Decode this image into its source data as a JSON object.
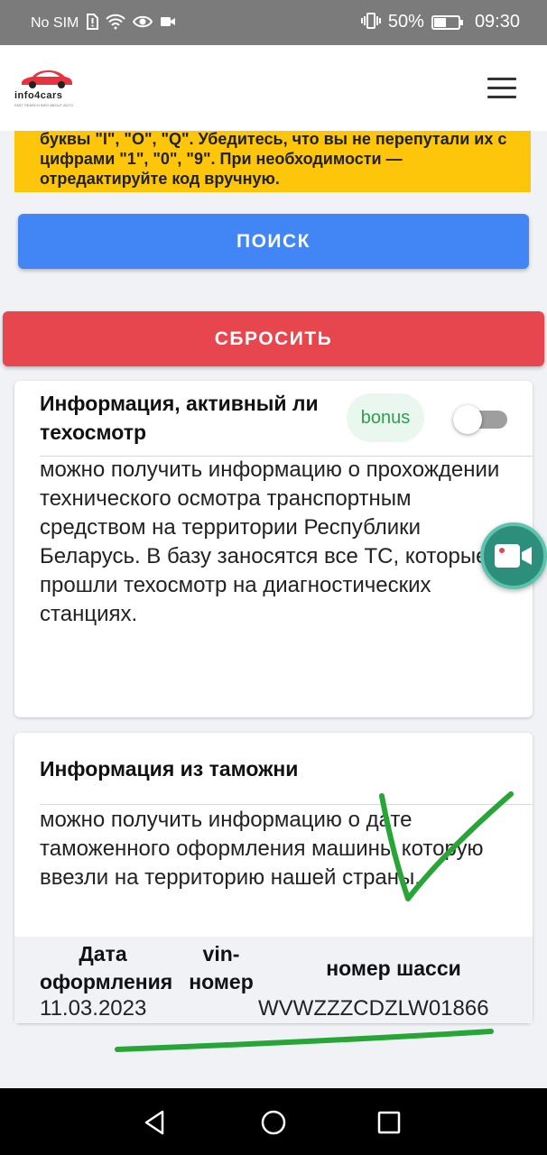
{
  "status_bar": {
    "carrier": "No SIM",
    "battery": "50%",
    "battery_level": 0.5,
    "time": "09:30",
    "icons": [
      "sim-alert-icon",
      "wifi-icon",
      "eye-icon",
      "video-icon",
      "vibrate-icon",
      "battery-icon"
    ]
  },
  "header": {
    "logo_text": "info4cars",
    "logo_subtext": "FAST SEARCH INFO ABOUT AUTO",
    "menu_icon": "hamburger-icon"
  },
  "warning": {
    "text": "буквы \"I\", \"O\", \"Q\". Убедитесь, что вы не перепутали их с цифрами \"1\", \"0\", \"9\". При необходимости — отредактируйте код вручную."
  },
  "buttons": {
    "search_label": "ПОИСК",
    "reset_label": "СБРОСИТЬ"
  },
  "tech_inspection_card": {
    "title": "Информация, активный ли техосмотр",
    "badge": "bonus",
    "toggle_on": false,
    "description": "можно получить информацию о прохождении технического осмотра транспортным средством на территории Республики Беларусь. В базу заносятся все ТС, которые прошли техосмотр на диагностических станциях."
  },
  "customs_card": {
    "title": "Информация из таможни",
    "description": "можно получить информацию о дате таможенного оформления машины которую ввезли на территорию нашей страны.",
    "table": {
      "headers": [
        "Дата оформления",
        "vin-номер",
        "номер шасси"
      ],
      "rows": [
        [
          "11.03.2023",
          "",
          "WVWZZZCDZLW01866"
        ]
      ]
    }
  },
  "fab": {
    "icon": "video-camera-icon"
  },
  "colors": {
    "accent_blue": "#4286f5",
    "accent_red": "#e8464f",
    "warning_yellow": "#fec60b",
    "bonus_green": "#2f9e4f",
    "annotation_green": "#27a536",
    "fab_teal": "#2c8f7c"
  },
  "nav_bar": {
    "icons": [
      "back-icon",
      "home-icon",
      "recent-apps-icon"
    ]
  }
}
